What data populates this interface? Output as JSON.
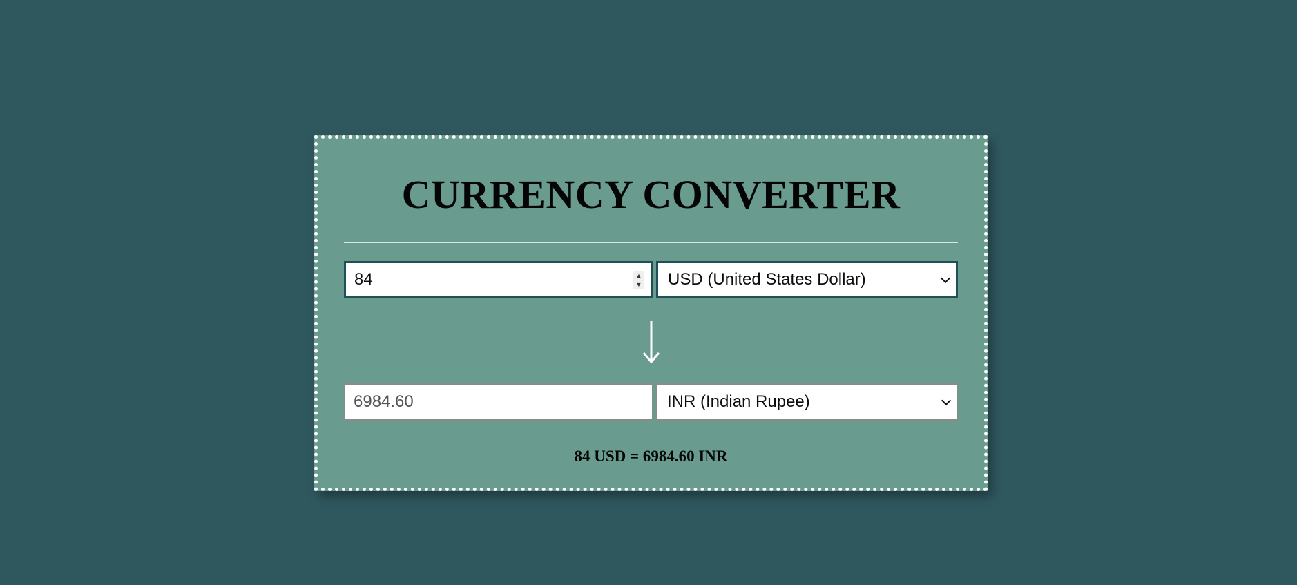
{
  "converter": {
    "title": "CURRENCY CONVERTER",
    "from": {
      "amount": "84",
      "currency": "USD (United States Dollar)"
    },
    "to": {
      "amount": "6984.60",
      "currency": "INR (Indian Rupee)"
    },
    "result_text": "84 USD = 6984.60 INR"
  },
  "icons": {
    "arrow": "arrow-down-icon",
    "spinner": "number-spinner-icon",
    "dropdown": "chevron-down-icon"
  },
  "colors": {
    "page_background": "#2f585e",
    "card_background": "#6a9b8f",
    "card_border": "#ffffff",
    "focus_border": "#1f4f57"
  }
}
